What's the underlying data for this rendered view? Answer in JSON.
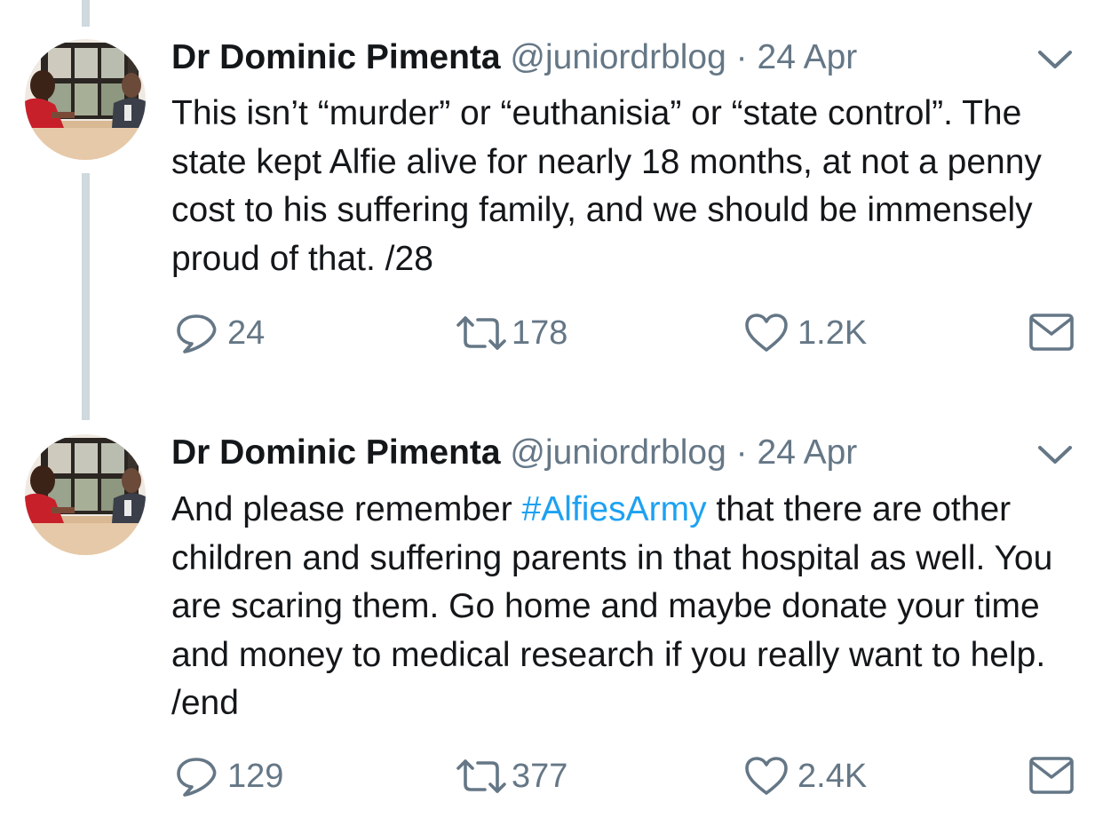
{
  "colors": {
    "text": "#14171a",
    "muted": "#657786",
    "link": "#1da1f2",
    "thread_line": "#cfd9de"
  },
  "tweets": [
    {
      "author": {
        "name": "Dr Dominic Pimenta",
        "handle": "@juniordrblog",
        "separator": "·",
        "date": "24 Apr"
      },
      "text_segments": [
        {
          "text": "This isn’t “murder” or “euthanisia” or “state control”. The state kept Alfie alive for nearly 18 months, at not a penny cost to his suffering family, and we should be immensely proud of that. /28"
        }
      ],
      "actions": {
        "replies": "24",
        "retweets": "178",
        "likes": "1.2K"
      },
      "icons": [
        "reply-icon",
        "retweet-icon",
        "like-icon",
        "direct-message-icon",
        "chevron-down-icon"
      ]
    },
    {
      "author": {
        "name": "Dr Dominic Pimenta",
        "handle": "@juniordrblog",
        "separator": "·",
        "date": "24 Apr"
      },
      "text_segments": [
        {
          "text": "And please remember "
        },
        {
          "text": "#AlfiesArmy"
        },
        {
          "text": " that there are other children and suffering parents in that hospital as well. You are scaring them. Go home and maybe donate your time and money to medical research if you really want to help. /end"
        }
      ],
      "actions": {
        "replies": "129",
        "retweets": "377",
        "likes": "2.4K"
      },
      "icons": [
        "reply-icon",
        "retweet-icon",
        "like-icon",
        "direct-message-icon",
        "chevron-down-icon"
      ]
    }
  ]
}
